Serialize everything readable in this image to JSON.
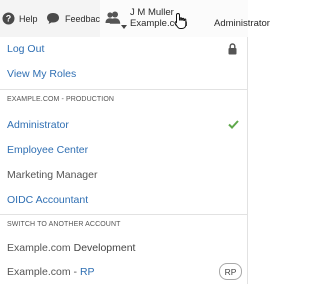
{
  "topbar": {
    "help_label": "Help",
    "feedback_label": "Feedback",
    "user_name": "J M Muller",
    "user_org": "Example.com",
    "user_role": "Administrator"
  },
  "menu": {
    "logout_label": "Log Out",
    "view_roles_label": "View My Roles",
    "production_section_label": "EXAMPLE.COM - PRODUCTION",
    "roles": [
      {
        "label": "Administrator",
        "checked": true
      },
      {
        "label": "Employee Center"
      },
      {
        "label": "Marketing Manager"
      },
      {
        "label": "OIDC Accountant"
      }
    ],
    "switch_section_label": "SWITCH TO ANOTHER ACCOUNT",
    "accounts": [
      {
        "label_main": "Example.com",
        "label_suffix": "Development"
      },
      {
        "label_main": "Example.com - ",
        "label_suffix": "RP",
        "badge": "RP"
      }
    ]
  },
  "colors": {
    "link": "#2f6fb3",
    "check": "#5fa84b",
    "topbar_bg": "#f4f4f4"
  }
}
